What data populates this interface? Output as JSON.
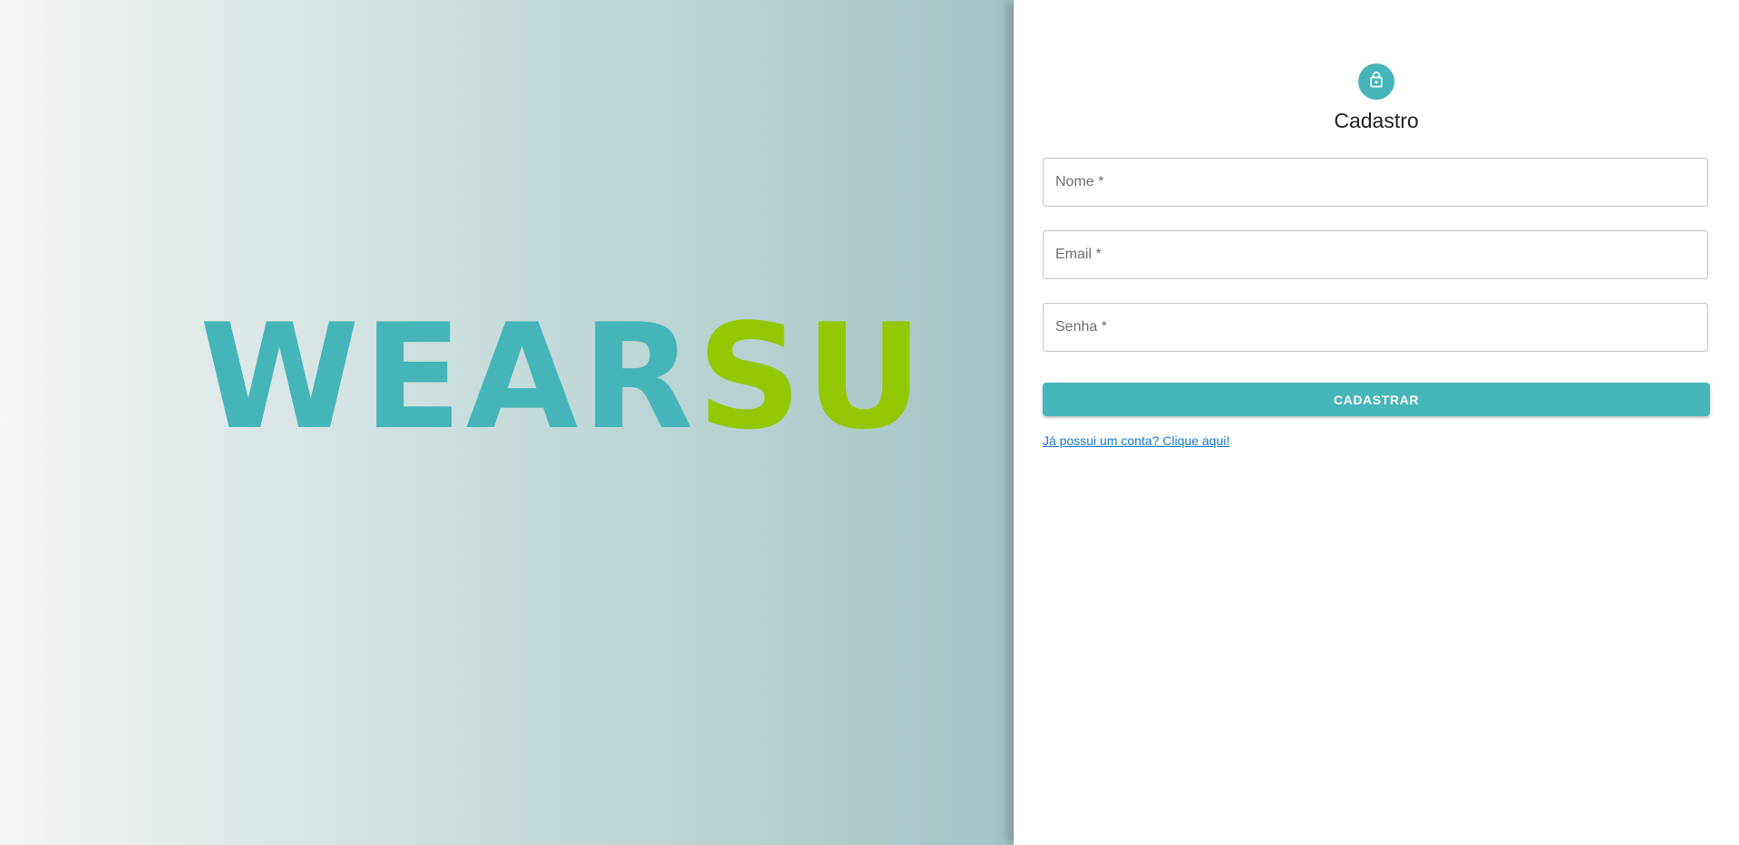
{
  "logo": {
    "part_a": "WEAR",
    "part_b": "SU",
    "color_a": "#45b5b9",
    "color_b": "#93c700"
  },
  "form": {
    "icon": "lock-icon",
    "title": "Cadastro",
    "fields": {
      "nome": {
        "placeholder": "Nome *",
        "value": ""
      },
      "email": {
        "placeholder": "Email *",
        "value": ""
      },
      "senha": {
        "placeholder": "Senha *",
        "value": ""
      }
    },
    "submit_label": "CADASTRAR",
    "login_link": "Já possui um conta? Clique aqui!"
  },
  "colors": {
    "accent": "#45b5b9",
    "link": "#1976d2"
  }
}
